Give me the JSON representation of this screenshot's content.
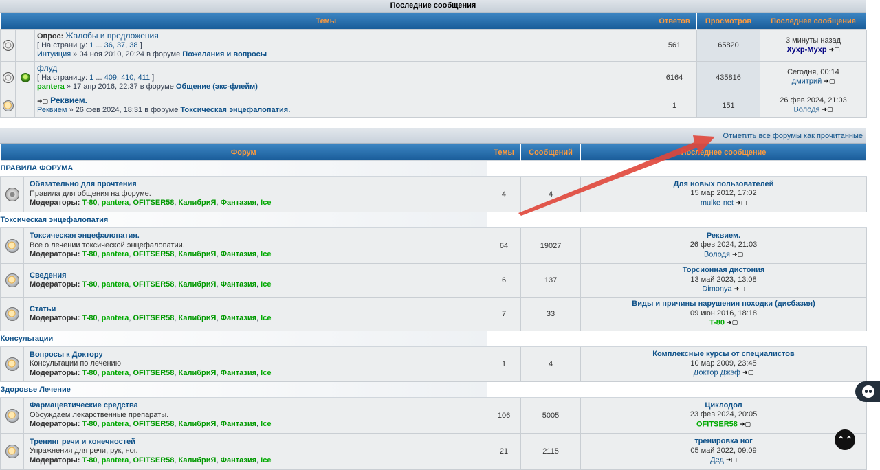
{
  "latest": {
    "caption": "Последние сообщения",
    "headers": {
      "topics": "Темы",
      "replies": "Ответов",
      "views": "Просмотров",
      "last": "Последнее сообщение"
    },
    "rows": [
      {
        "prefix": "Опрос:",
        "title": "Жалобы и предложения",
        "pages_label": "[ На страницу:",
        "pages": [
          "1",
          "...",
          "36,",
          "37,",
          "38"
        ],
        "pages_end": "]",
        "author": "Интуиция",
        "date": "» 04 ноя 2010, 20:24 в форуме",
        "forum": "Пожелания и вопросы",
        "replies": "561",
        "views": "65820",
        "last_time": "3 минуты назад",
        "last_user": "Хухр-Мухр",
        "goto": "➜▢"
      },
      {
        "prefix": "",
        "title": "флуд",
        "pages_label": "[ На страницу:",
        "pages": [
          "1",
          "...",
          "409,",
          "410,",
          "411"
        ],
        "pages_end": "]",
        "author": "pantera",
        "date": "» 17 апр 2016, 22:37 в форуме",
        "forum": "Общение (экс-флейм)",
        "replies": "6164",
        "views": "435816",
        "last_time": "Сегодня, 00:14",
        "last_user": "дмитрий",
        "goto": "➜▢"
      },
      {
        "prefix": "",
        "title": "Реквием.",
        "author": "Реквием",
        "date": "» 26 фев 2024, 18:31 в форуме",
        "forum": "Токсическая энцефалопатия.",
        "replies": "1",
        "views": "151",
        "last_time": "26 фев 2024, 21:03",
        "last_user": "Володя",
        "goto": "➜▢"
      }
    ]
  },
  "markread": "Отметить все форумы как прочитанные",
  "forums": {
    "headers": {
      "forum": "Форум",
      "topics": "Темы",
      "posts": "Сообщений",
      "last": "Последнее сообщение"
    },
    "mods_label": "Модераторы:",
    "moderators": [
      "T-80",
      "pantera",
      "OFITSER58",
      "КалибриЯ",
      "Фантазия",
      "Ice"
    ],
    "categories": [
      {
        "name": "ПРАВИЛА ФОРУМА",
        "forums": [
          {
            "name": "Обязательно для прочтения",
            "desc": "Правила для общения на форуме.",
            "topics": "4",
            "posts": "4",
            "last_title": "Для новых пользователей",
            "last_date": "15 мар 2012, 17:02",
            "last_user": "mulke-net",
            "icon": "lock-icon"
          }
        ]
      },
      {
        "name": "Токсическая энцефалопатия",
        "forums": [
          {
            "name": "Токсическая энцефалопатия.",
            "desc": "Все о лечении токсической энцефалопатии.",
            "topics": "64",
            "posts": "19027",
            "last_title": "Реквием.",
            "last_date": "26 фев 2024, 21:03",
            "last_user": "Володя",
            "icon": "forum-icon"
          },
          {
            "name": "Сведения",
            "desc": "",
            "topics": "6",
            "posts": "137",
            "last_title": "Торсионная дистония",
            "last_date": "13 май 2023, 13:08",
            "last_user": "Dimonya",
            "icon": "forum-icon"
          },
          {
            "name": "Статьи",
            "desc": "",
            "topics": "7",
            "posts": "33",
            "last_title": "Виды и причины нарушения походки (дисбазия)",
            "last_date": "09 июн 2016, 18:18",
            "last_user": "T-80",
            "icon": "forum-icon"
          }
        ]
      },
      {
        "name": "Консультации",
        "forums": [
          {
            "name": "Вопросы к Доктору",
            "desc": "Консультации по лечению",
            "topics": "1",
            "posts": "4",
            "last_title": "Комплексные курсы от специалистов",
            "last_date": "10 мар 2009, 23:45",
            "last_user": "Доктор Джэф",
            "icon": "forum-icon"
          }
        ]
      },
      {
        "name": "Здоровье Лечение",
        "forums": [
          {
            "name": "Фармацевтические средства",
            "desc": "Обсуждаем лекарственные препараты.",
            "topics": "106",
            "posts": "5005",
            "last_title": "Циклодол",
            "last_date": "23 фев 2024, 20:05",
            "last_user": "OFITSER58",
            "icon": "forum-icon"
          },
          {
            "name": "Тренинг речи и конечностей",
            "desc": "Упражнения для речи, рук, ног.",
            "topics": "21",
            "posts": "2115",
            "last_title": "тренировка ног",
            "last_date": "05 май 2022, 09:09",
            "last_user": "Дед",
            "icon": "forum-icon"
          }
        ]
      }
    ]
  },
  "colors": {
    "header_blue": "#1a5d9a",
    "header_text": "#ff9a3c",
    "link": "#105289",
    "mod_green": "#00aa00",
    "arrow_red": "#e0463a"
  },
  "widgets": {
    "scroll_top": "⌃⌃"
  }
}
